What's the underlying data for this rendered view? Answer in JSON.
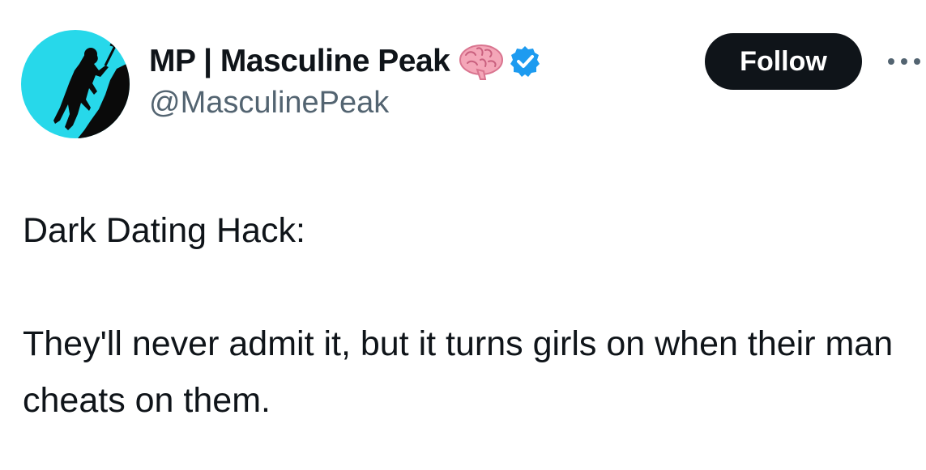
{
  "author": {
    "display_name": "MP | Masculine Peak",
    "handle": "@MasculinePeak",
    "avatar_icon": "climber-silhouette-icon",
    "emoji_icon": "brain-icon",
    "verified_icon": "verified-badge-icon",
    "colors": {
      "avatar_bg": "#27d8ea",
      "verified": "#1d9bf0"
    }
  },
  "actions": {
    "follow_label": "Follow",
    "more_icon": "more-options-icon"
  },
  "tweet": {
    "lines": [
      "Dark Dating Hack:",
      "They'll never admit it, but it turns girls on when their man cheats on them."
    ]
  }
}
